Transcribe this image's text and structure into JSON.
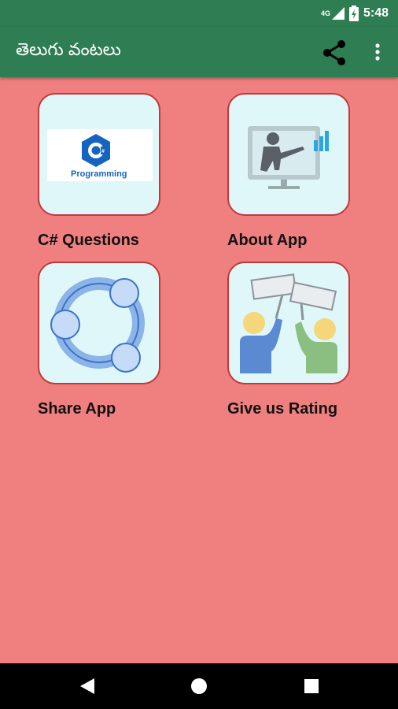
{
  "status": {
    "signal": "4G",
    "time": "5:48"
  },
  "app_bar": {
    "title": "తెలుగు వంటలు"
  },
  "tiles": [
    {
      "label": "C# Questions",
      "icon": "csharp-programming-icon",
      "icon_text": "Programming"
    },
    {
      "label": "About App",
      "icon": "presentation-icon"
    },
    {
      "label": "Share App",
      "icon": "share-circle-icon"
    },
    {
      "label": "Give us Rating",
      "icon": "rating-people-icon"
    }
  ],
  "colors": {
    "app_bar": "#2f7d53",
    "background": "#f08080",
    "tile_fill": "#e0f7fa",
    "tile_border": "#c0393b"
  }
}
